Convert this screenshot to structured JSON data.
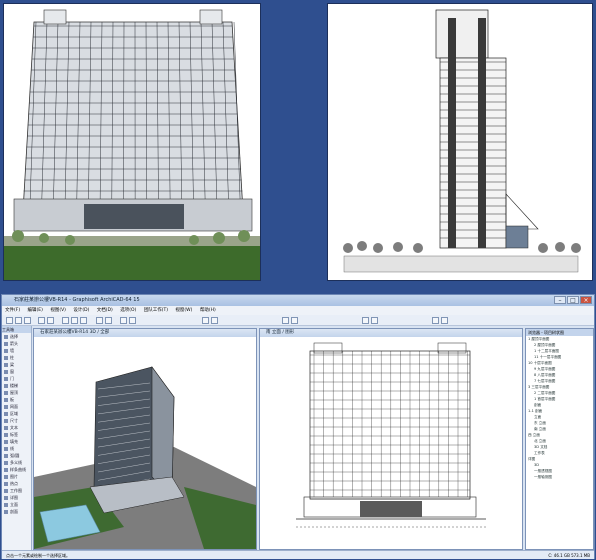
{
  "app": {
    "title": "石家莊某辦公樓VB-R14 - Graphisoft ArchiCAD-64 15",
    "menus": [
      "文件(F)",
      "编辑(E)",
      "视图(V)",
      "设计(D)",
      "文档(D)",
      "选项(O)",
      "团队工作(T)",
      "视窗(W)",
      "帮助(H)"
    ]
  },
  "toolbox": {
    "title": "工具箱",
    "items": [
      "选择",
      "箭头",
      "墙",
      "柱",
      "梁",
      "窗",
      "门",
      "楼梯",
      "屋顶",
      "板",
      "网面",
      "区域",
      "尺寸",
      "文本",
      "标签",
      "填充",
      "线",
      "弧/圆",
      "多义线",
      "样条曲线",
      "图片",
      "热点",
      "工作图",
      "详图",
      "立面",
      "剖面"
    ]
  },
  "windows": {
    "view3d_title": "石家莊某辦公樓VB-R14 3D / 全部",
    "elevation_title": "南 立面 / 图形"
  },
  "navigator": {
    "title": "浏览器 - 项目树状图",
    "items": [
      "1 屋顶平面图",
      "2 屋顶平面图",
      "1 十二层平面图",
      "11 十一层平面图",
      "10 十层平面图",
      "9 九层平面图",
      "8 八层平面图",
      "7 七层平面图",
      "3 三层平面图",
      "2 二层平面图",
      "1 首层平面图",
      "剖面",
      "1-1 剖面",
      "立面",
      "东 立面",
      "南 立面",
      "西 立面",
      "北 立面",
      "3D 文档",
      "工作表",
      "详图",
      "3D",
      "一般透视图",
      "一般轴测图"
    ]
  },
  "statusbar": {
    "left": "点击一个元素或绘制一个选择区域。",
    "right": "C: 46.1 GB  573.1 MB"
  }
}
